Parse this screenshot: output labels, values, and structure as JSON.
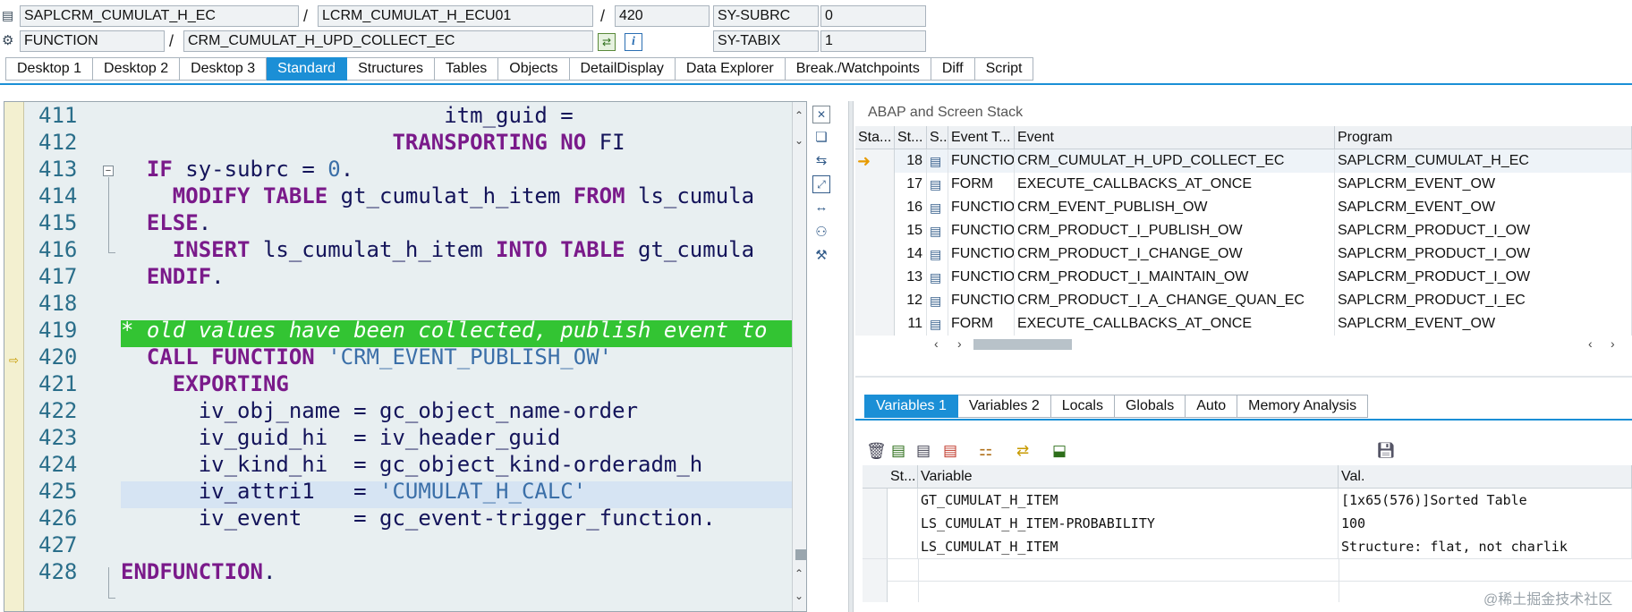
{
  "header": {
    "program": "SAPLCRM_CUMULAT_H_EC",
    "include": "LCRM_CUMULAT_H_ECU01",
    "line": "420",
    "event_type": "FUNCTION",
    "event": "CRM_CUMULAT_H_UPD_COLLECT_EC",
    "sysvars": [
      {
        "name": "SY-SUBRC",
        "value": "0"
      },
      {
        "name": "SY-TABIX",
        "value": "1"
      }
    ],
    "separator": "/"
  },
  "tabs": [
    "Desktop 1",
    "Desktop 2",
    "Desktop 3",
    "Standard",
    "Structures",
    "Tables",
    "Objects",
    "DetailDisplay",
    "Data Explorer",
    "Break./Watchpoints",
    "Diff",
    "Script"
  ],
  "active_tab": "Standard",
  "code": [
    {
      "ln": "411",
      "text": "                         itm_guid ="
    },
    {
      "ln": "412",
      "text": "                     TRANSPORTING NO FI"
    },
    {
      "ln": "413",
      "text": "  IF sy-subrc = 0."
    },
    {
      "ln": "414",
      "text": "    MODIFY TABLE gt_cumulat_h_item FROM ls_cumula"
    },
    {
      "ln": "415",
      "text": "  ELSE."
    },
    {
      "ln": "416",
      "text": "    INSERT ls_cumulat_h_item INTO TABLE gt_cumula"
    },
    {
      "ln": "417",
      "text": "  ENDIF."
    },
    {
      "ln": "418",
      "text": ""
    },
    {
      "ln": "419",
      "text": "* old values have been collected, publish event to"
    },
    {
      "ln": "420",
      "text": "  CALL FUNCTION 'CRM_EVENT_PUBLISH_OW'"
    },
    {
      "ln": "421",
      "text": "    EXPORTING"
    },
    {
      "ln": "422",
      "text": "      iv_obj_name = gc_object_name-order"
    },
    {
      "ln": "423",
      "text": "      iv_guid_hi  = iv_header_guid"
    },
    {
      "ln": "424",
      "text": "      iv_kind_hi  = gc_object_kind-orderadm_h"
    },
    {
      "ln": "425",
      "text": "      iv_attri1   = 'CUMULAT_H_CALC'"
    },
    {
      "ln": "426",
      "text": "      iv_event    = gc_event-trigger_function."
    },
    {
      "ln": "427",
      "text": ""
    },
    {
      "ln": "428",
      "text": "ENDFUNCTION."
    }
  ],
  "stack": {
    "title": "ABAP and Screen Stack",
    "columns": [
      "Sta...",
      "St...",
      "S..",
      "Event T...",
      "Event",
      "Program"
    ],
    "rows": [
      {
        "level": "18",
        "type": "FUNCTIO...",
        "event": "CRM_CUMULAT_H_UPD_COLLECT_EC",
        "program": "SAPLCRM_CUMULAT_H_EC",
        "current": true
      },
      {
        "level": "17",
        "type": "FORM",
        "event": "EXECUTE_CALLBACKS_AT_ONCE",
        "program": "SAPLCRM_EVENT_OW",
        "current": false
      },
      {
        "level": "16",
        "type": "FUNCTIO...",
        "event": "CRM_EVENT_PUBLISH_OW",
        "program": "SAPLCRM_EVENT_OW",
        "current": false
      },
      {
        "level": "15",
        "type": "FUNCTIO...",
        "event": "CRM_PRODUCT_I_PUBLISH_OW",
        "program": "SAPLCRM_PRODUCT_I_OW",
        "current": false
      },
      {
        "level": "14",
        "type": "FUNCTIO...",
        "event": "CRM_PRODUCT_I_CHANGE_OW",
        "program": "SAPLCRM_PRODUCT_I_OW",
        "current": false
      },
      {
        "level": "13",
        "type": "FUNCTIO...",
        "event": "CRM_PRODUCT_I_MAINTAIN_OW",
        "program": "SAPLCRM_PRODUCT_I_OW",
        "current": false
      },
      {
        "level": "12",
        "type": "FUNCTIO...",
        "event": "CRM_PRODUCT_I_A_CHANGE_QUAN_EC",
        "program": "SAPLCRM_PRODUCT_I_EC",
        "current": false
      },
      {
        "level": "11",
        "type": "FORM",
        "event": "EXECUTE_CALLBACKS_AT_ONCE",
        "program": "SAPLCRM_EVENT_OW",
        "current": false
      }
    ]
  },
  "var_tabs": [
    "Variables 1",
    "Variables 2",
    "Locals",
    "Globals",
    "Auto",
    "Memory Analysis"
  ],
  "active_var_tab": "Variables 1",
  "variables": {
    "columns": [
      "St...",
      "Variable",
      "Val."
    ],
    "rows": [
      {
        "name": "GT_CUMULAT_H_ITEM",
        "value": "[1x65(576)]Sorted Table"
      },
      {
        "name": "LS_CUMULAT_H_ITEM-PROBABILITY",
        "value": "100"
      },
      {
        "name": "LS_CUMULAT_H_ITEM",
        "value": "Structure: flat, not charlik"
      }
    ]
  },
  "watermark": "@稀土掘金技术社区",
  "colors": {
    "accent": "#1b8fd6",
    "comment_bg": "#33c433",
    "keyword": "#7a1a8a",
    "string": "#3b6fa8"
  }
}
